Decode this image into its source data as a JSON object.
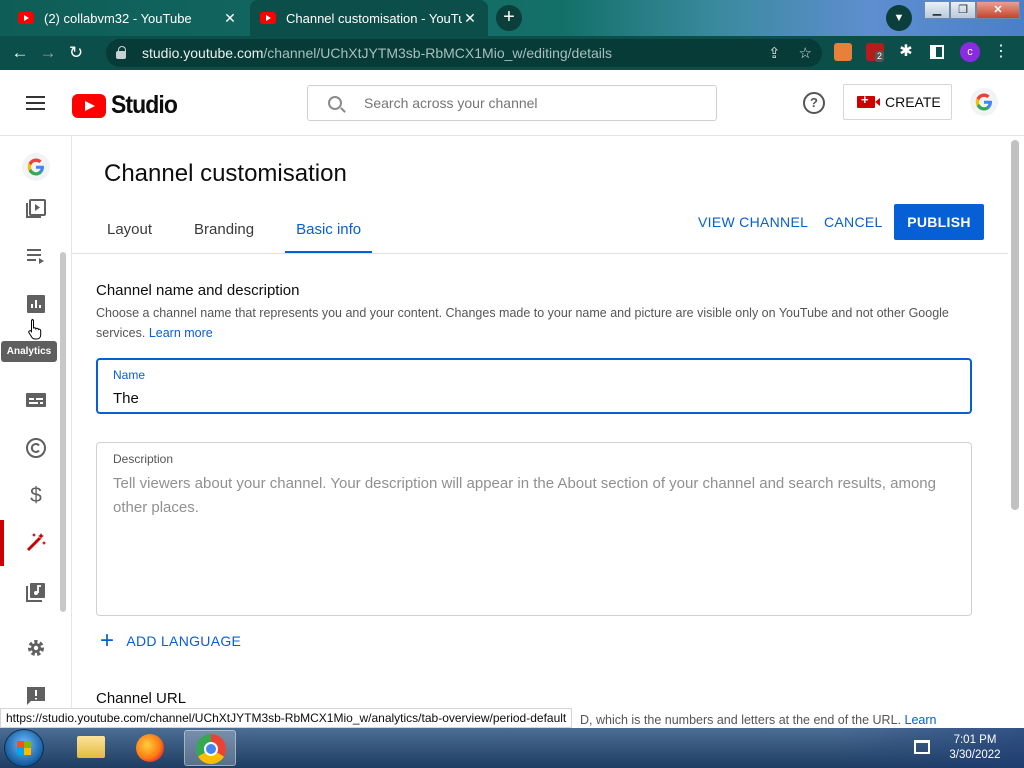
{
  "browser": {
    "tabs": [
      {
        "title": "(2) collabvm32 - YouTube",
        "active": false
      },
      {
        "title": "Channel customisation - YouTube",
        "active": true
      }
    ],
    "url_host": "studio.youtube.com",
    "url_path": "/channel/UChXtJYTM3sb-RbMCX1Mio_w/editing/details",
    "profile_initial": "c",
    "extension_badge": "2"
  },
  "header": {
    "logo_text": "Studio",
    "search_placeholder": "Search across your channel",
    "create_label": "CREATE"
  },
  "rail": {
    "tooltip": "Analytics",
    "items": [
      "channel-avatar",
      "content",
      "playlists",
      "analytics",
      "subtitles",
      "copyright",
      "earn",
      "customisation",
      "audio-library",
      "settings",
      "send-feedback"
    ],
    "active": "customisation"
  },
  "page": {
    "title": "Channel customisation",
    "tabs": [
      "Layout",
      "Branding",
      "Basic info"
    ],
    "active_tab": "Basic info",
    "actions": {
      "view_channel": "VIEW CHANNEL",
      "cancel": "CANCEL",
      "publish": "PUBLISH"
    },
    "section": {
      "heading": "Channel name and description",
      "text": "Choose a channel name that represents you and your content. Changes made to your name and picture are visible only on YouTube and not other Google services.",
      "learn_more": "Learn more"
    },
    "name_field": {
      "label": "Name",
      "value": "The"
    },
    "description_field": {
      "label": "Description",
      "placeholder": "Tell viewers about your channel. Your description will appear in the About section of your channel and search results, among other places."
    },
    "add_language": "ADD LANGUAGE",
    "channel_url": {
      "heading": "Channel URL",
      "text_tail": "D, which is the numbers and letters at the end of the URL.",
      "learn_link": "Learn"
    }
  },
  "status_bar_url": "https://studio.youtube.com/channel/UChXtJYTM3sb-RbMCX1Mio_w/analytics/tab-overview/period-default",
  "taskbar": {
    "apps": [
      "windows-explorer",
      "firefox",
      "chrome"
    ],
    "active_app": "chrome",
    "time": "7:01 PM",
    "date": "3/30/2022"
  },
  "colors": {
    "accent_blue": "#065fd4",
    "youtube_red": "#ff0000",
    "chrome_frame": "#0c4f4a"
  }
}
